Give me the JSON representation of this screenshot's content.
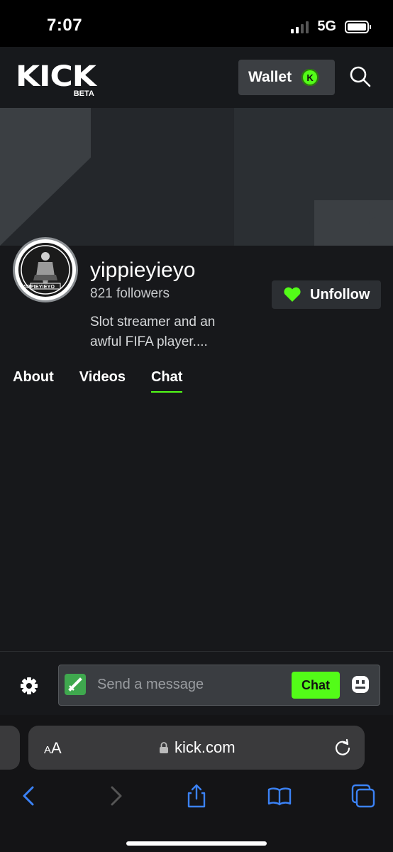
{
  "status_bar": {
    "time": "7:07",
    "network": "5G"
  },
  "header": {
    "logo_text": "KICK",
    "logo_badge": "BETA",
    "wallet_label": "Wallet",
    "wallet_coin_letter": "K"
  },
  "channel": {
    "username": "yippieyieyo",
    "followers": "821 followers",
    "bio": "Slot streamer and an awful FIFA player....",
    "avatar_caption": "YIPPIEYIEYO",
    "unfollow_label": "Unfollow"
  },
  "tabs": [
    {
      "label": "About",
      "active": false
    },
    {
      "label": "Videos",
      "active": false
    },
    {
      "label": "Chat",
      "active": true
    }
  ],
  "chat": {
    "placeholder": "Send a message",
    "send_label": "Chat"
  },
  "browser": {
    "text_size_label": "AA",
    "url": "kick.com"
  },
  "colors": {
    "accent_green": "#53fc18",
    "header_bg": "#17191c",
    "surface": "#17181b"
  },
  "icons": [
    "search-icon",
    "chevron-left-icon",
    "heart-icon",
    "gear-icon",
    "sword-icon",
    "emote-icon",
    "lock-icon",
    "reload-icon",
    "back-icon",
    "forward-icon",
    "share-icon",
    "bookmarks-icon",
    "tabs-icon"
  ]
}
